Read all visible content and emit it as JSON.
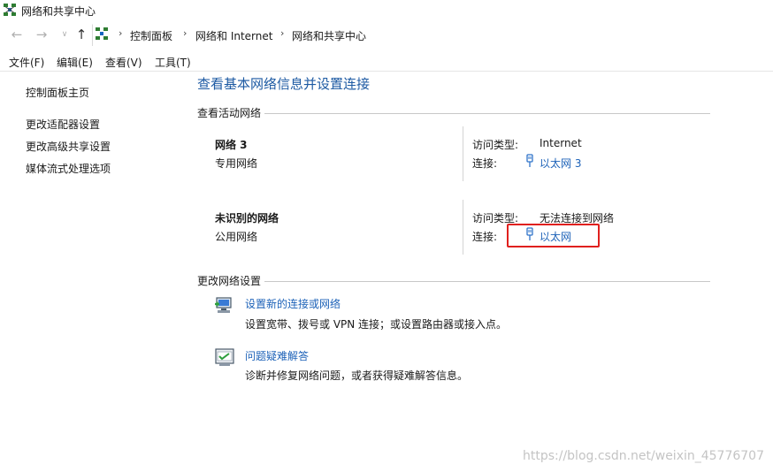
{
  "window": {
    "title": "网络和共享中心"
  },
  "address_bar": {
    "breadcrumbs": [
      "控制面板",
      "网络和 Internet",
      "网络和共享中心"
    ]
  },
  "menu": [
    "文件(F)",
    "编辑(E)",
    "查看(V)",
    "工具(T)"
  ],
  "sidebar": {
    "home": "控制面板主页",
    "links": [
      "更改适配器设置",
      "更改高级共享设置",
      "媒体流式处理选项"
    ]
  },
  "main": {
    "title": "查看基本网络信息并设置连接",
    "active_section": "查看活动网络",
    "networks": [
      {
        "name": "网络 3",
        "type": "专用网络",
        "access_label": "访问类型:",
        "access_value": "Internet",
        "conn_label": "连接:",
        "conn_value": "以太网 3"
      },
      {
        "name": "未识别的网络",
        "type": "公用网络",
        "access_label": "访问类型:",
        "access_value": "无法连接到网络",
        "conn_label": "连接:",
        "conn_value": "以太网"
      }
    ],
    "change_section": "更改网络设置",
    "tasks": [
      {
        "link": "设置新的连接或网络",
        "desc": "设置宽带、拨号或 VPN 连接；或设置路由器或接入点。"
      },
      {
        "link": "问题疑难解答",
        "desc": "诊断并修复网络问题，或者获得疑难解答信息。"
      }
    ]
  },
  "watermark": "https://blog.csdn.net/weixin_45776707",
  "colors": {
    "link": "#1d62b8",
    "title": "#1d5aa3",
    "highlight": "#e0201e"
  }
}
